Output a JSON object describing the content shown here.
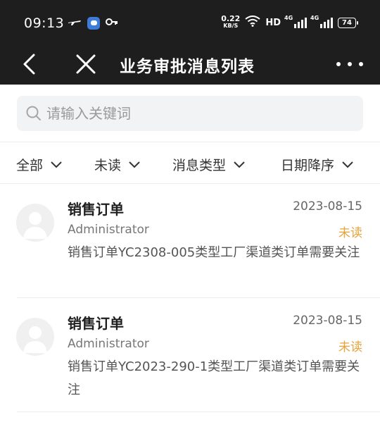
{
  "status_bar": {
    "time": "09:13",
    "net_speed_value": "0.22",
    "net_speed_unit": "KB/S",
    "hd_label": "HD",
    "signal1_label": "4G",
    "signal2_label": "4G",
    "battery_level": "74"
  },
  "header": {
    "title": "业务审批消息列表"
  },
  "search": {
    "placeholder": "请输入关键词",
    "value": ""
  },
  "filters": [
    {
      "label": "全部"
    },
    {
      "label": "未读"
    },
    {
      "label": "消息类型"
    },
    {
      "label": "日期降序"
    }
  ],
  "messages": [
    {
      "title": "销售订单",
      "date": "2023-08-15",
      "sender": "Administrator",
      "status": "未读",
      "body": "销售订单YC2308-005类型工厂渠道类订单需要关注"
    },
    {
      "title": "销售订单",
      "date": "2023-08-15",
      "sender": "Administrator",
      "status": "未读",
      "body": "销售订单YC2023-290-1类型工厂渠道类订单需要关注"
    }
  ],
  "colors": {
    "header_bg": "#1e1e1e",
    "unread_status": "#e8a33a",
    "search_bg": "#f2f3f5"
  }
}
